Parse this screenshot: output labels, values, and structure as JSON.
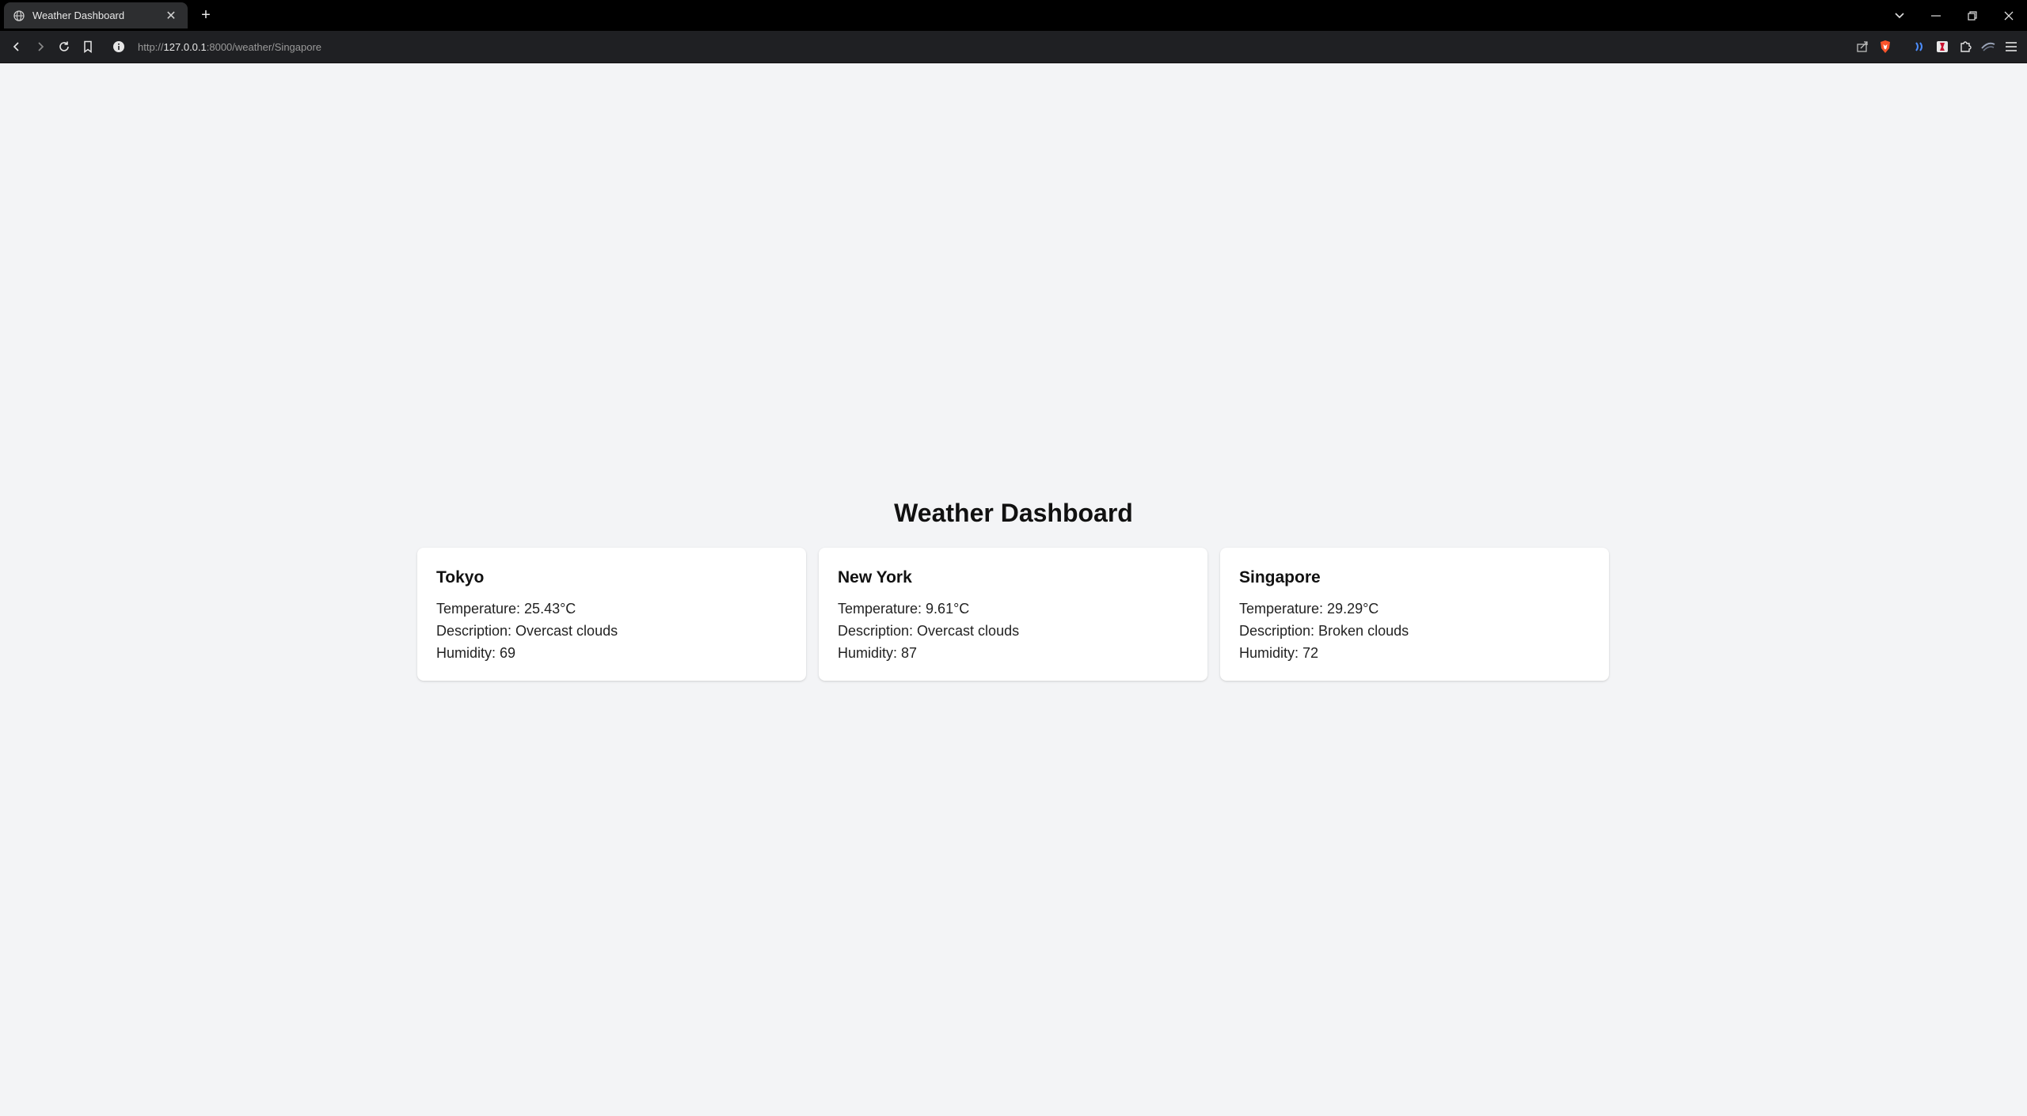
{
  "browser": {
    "tab_title": "Weather Dashboard",
    "new_tab_label": "+",
    "url_scheme": "http://",
    "url_host": "127.0.0.1",
    "url_rest": ":8000/weather/Singapore"
  },
  "dashboard": {
    "title": "Weather Dashboard",
    "cities": [
      {
        "name": "Tokyo",
        "temperature": "Temperature: 25.43°C",
        "description": "Description: Overcast clouds",
        "humidity": "Humidity: 69"
      },
      {
        "name": "New York",
        "temperature": "Temperature: 9.61°C",
        "description": "Description: Overcast clouds",
        "humidity": "Humidity: 87"
      },
      {
        "name": "Singapore",
        "temperature": "Temperature: 29.29°C",
        "description": "Description: Broken clouds",
        "humidity": "Humidity: 72"
      }
    ]
  },
  "colors": {
    "page_background": "#f3f4f6",
    "card_background": "#ffffff",
    "brave_lion": "#fb542b"
  }
}
